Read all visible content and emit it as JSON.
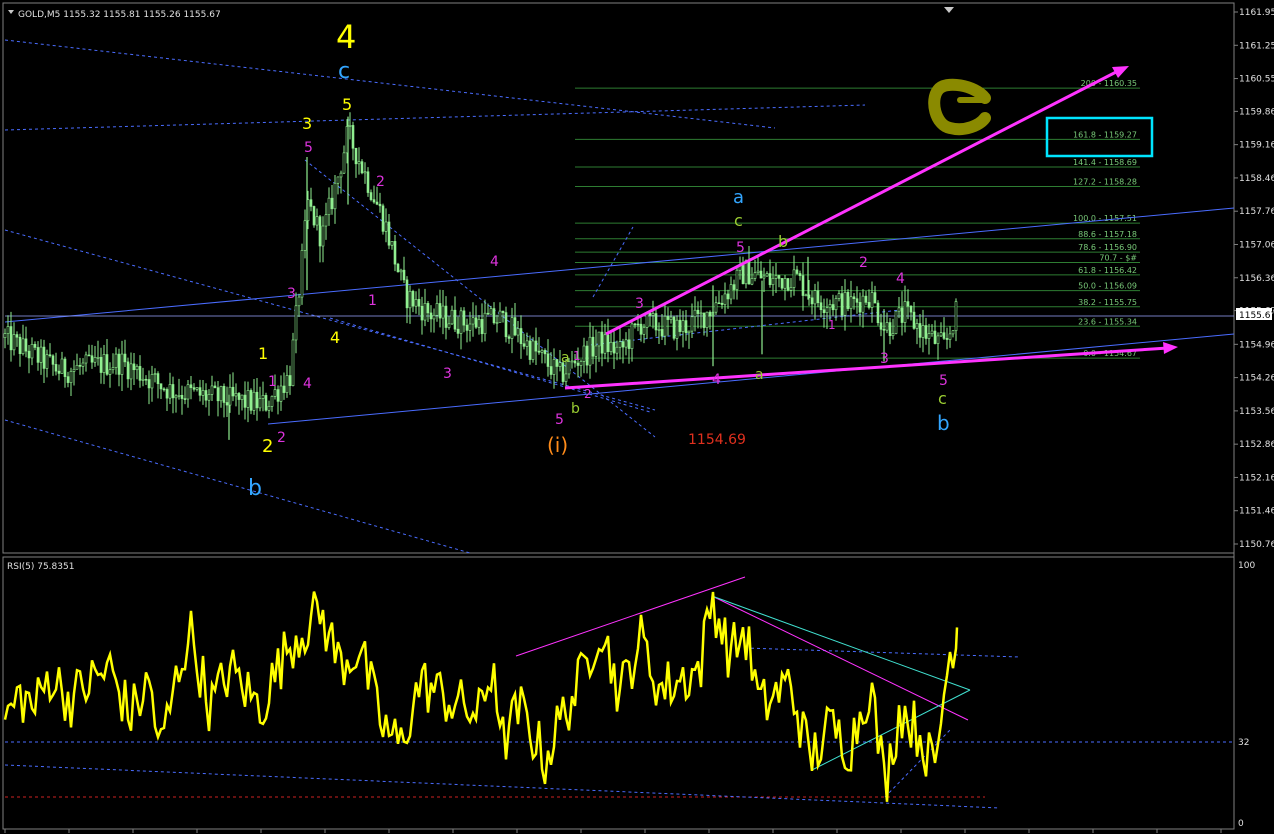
{
  "main_chart": {
    "title": "GOLD,M5  1155.32 1155.81 1155.26 1155.67",
    "price_ticks": [
      "1161.95",
      "1161.25",
      "1160.55",
      "1159.86",
      "1159.16",
      "1158.46",
      "1157.76",
      "1157.06",
      "1156.36",
      "1155.67",
      "1154.96",
      "1154.26",
      "1153.56",
      "1152.86",
      "1152.16",
      "1151.46",
      "1150.76"
    ],
    "current_price": "1155.67",
    "fib_levels": [
      {
        "label": "200 - 1160.35",
        "value": 1160.35
      },
      {
        "label": "161.8 - 1159.27",
        "value": 1159.27
      },
      {
        "label": "141.4 - 1158.69",
        "value": 1158.69
      },
      {
        "label": "127.2 - 1158.28",
        "value": 1158.28
      },
      {
        "label": "100.0 - 1157.51",
        "value": 1157.51
      },
      {
        "label": "88.6 - 1157.18",
        "value": 1157.18
      },
      {
        "label": "78.6 - 1156.90",
        "value": 1156.9
      },
      {
        "label": "70.7 - $#",
        "value": 1156.68
      },
      {
        "label": "61.8 - 1156.42",
        "value": 1156.42
      },
      {
        "label": "50.0 - 1156.09",
        "value": 1156.09
      },
      {
        "label": "38.2 - 1155.75",
        "value": 1155.75
      },
      {
        "label": "23.6 - 1155.34",
        "value": 1155.34
      },
      {
        "label": "0.0 - 1154.67",
        "value": 1154.67
      }
    ],
    "price_annotation": "1154.69",
    "wave_labels": {
      "big4": "4",
      "big_c": "c",
      "big_b": "b",
      "y5": "5",
      "y3": "3",
      "y1": "1",
      "y2": "2",
      "y4": "4",
      "m5": "5",
      "m2": "2",
      "m1": "1",
      "m3": "3",
      "m4": "4",
      "m1b": "1",
      "m4b": "4",
      "m2b": "2",
      "m3b": "3",
      "wave_i": "(i)",
      "g_a": "a",
      "g_b": "b",
      "g_c": "c",
      "p1": "1",
      "p2": "2",
      "p3": "3",
      "p4": "4",
      "p5": "5",
      "blue_a": "a",
      "green_c": "c",
      "m5b": "5",
      "g_bb": "b",
      "p2b": "2",
      "p4b": "4",
      "p1b": "1",
      "p3b": "3",
      "p5b": "5",
      "g_a2": "a",
      "g_c2": "c",
      "blue_b2": "b"
    }
  },
  "rsi_panel": {
    "title": "RSI(5) 75.8351",
    "ticks": [
      "100",
      "32",
      "0"
    ]
  },
  "chart_data": {
    "type": "line",
    "series": [
      {
        "name": "GOLD,M5",
        "kind": "candlestick"
      },
      {
        "name": "RSI(5)",
        "last_value": 75.8351
      }
    ],
    "ylim_price": [
      1150.76,
      1161.95
    ],
    "ylim_rsi": [
      0,
      100
    ],
    "fib_extension": [
      "200",
      "161.8",
      "141.4",
      "127.2",
      "100.0",
      "88.6",
      "78.6",
      "70.7",
      "61.8",
      "50.0",
      "38.2",
      "23.6",
      "0.0"
    ]
  },
  "colors": {
    "candle": "#90ee90",
    "rsi": "#ffff00",
    "magenta": "#ff33ff",
    "blue_line": "#4a6cff",
    "fib": "#2e7d32",
    "cyan_box": "#00e5ff",
    "olive_mark": "#8a8a00"
  }
}
